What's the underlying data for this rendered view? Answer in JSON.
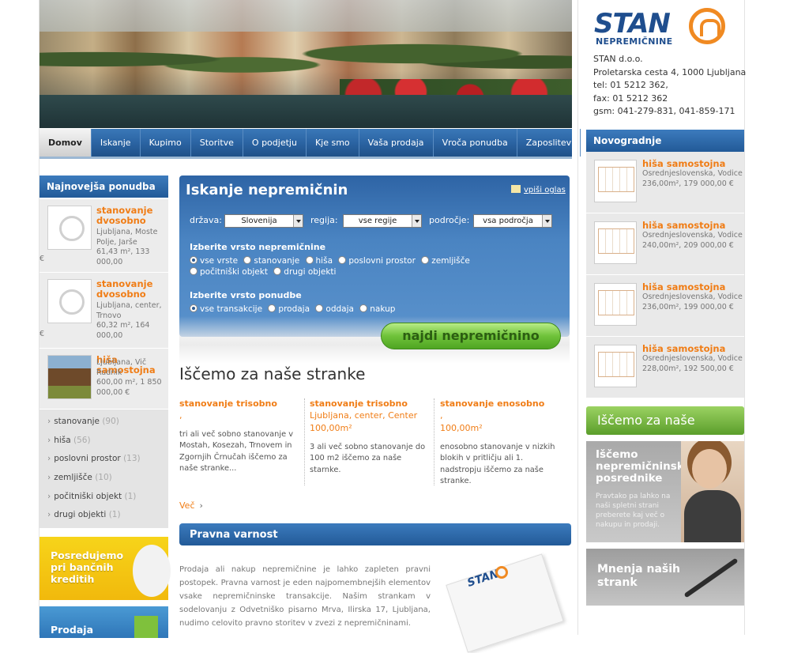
{
  "nav": {
    "items": [
      "Domov",
      "Iskanje",
      "Kupimo",
      "Storitve",
      "O podjetju",
      "Kje smo",
      "Vaša prodaja",
      "Vroča ponudba",
      "Zaposlitev"
    ]
  },
  "logo": {
    "brand": "STAN",
    "sub": "NEPREMIČNINE"
  },
  "company": {
    "name": "STAN d.o.o.",
    "address": "Proletarska cesta 4, 1000 Ljubljana",
    "tel": "tel: 01 5212 362,",
    "fax": "fax: 01 5212 362",
    "gsm": "gsm: 041-279-831, 041-859-171"
  },
  "newest": {
    "heading": "Najnovejša ponudba",
    "items": [
      {
        "title": "stanovanje dvosobno",
        "desc": "Ljubljana, Moste Polje, Jarše",
        "meta": "61,43 m², 133 000,00",
        "cur": "€"
      },
      {
        "title": "stanovanje dvosobno",
        "desc": "Ljubljana, center, Trnovo",
        "meta": "60,32 m², 164 000,00",
        "cur": "€"
      },
      {
        "title": "hiša samostojna",
        "desc": "Ljubljana, Vič Rudnik",
        "meta": "600,00 m², 1 850 000,00 €"
      }
    ]
  },
  "categories": [
    {
      "label": "stanovanje",
      "count": "(90)"
    },
    {
      "label": "hiša",
      "count": "(56)"
    },
    {
      "label": "poslovni prostor",
      "count": "(13)"
    },
    {
      "label": "zemljišče",
      "count": "(10)"
    },
    {
      "label": "počitniški objekt",
      "count": "(1)"
    },
    {
      "label": "drugi objekti",
      "count": "(1)"
    }
  ],
  "banners": {
    "credit": "Posredujemo pri bančnih kreditih",
    "sale": "Prodaja"
  },
  "search": {
    "title": "Iskanje nepremičnin",
    "add_listing": "vpiši oglas",
    "country_label": "država:",
    "country_value": "Slovenija",
    "region_label": "regija:",
    "region_value": "vse regije",
    "area_label": "področje:",
    "area_value": "vsa področja",
    "type_heading": "Izberite vrsto nepremičnine",
    "types": [
      "vse vrste",
      "stanovanje",
      "hiša",
      "poslovni prostor",
      "zemljišče",
      "počitniški objekt",
      "drugi objekti"
    ],
    "offer_heading": "Izberite vrsto ponudbe",
    "offers": [
      "vse transakcije",
      "prodaja",
      "oddaja",
      "nakup"
    ],
    "button": "najdi nepremičnino"
  },
  "wanted": {
    "heading": "Iščemo za naše stranke",
    "items": [
      {
        "title": "stanovanje trisobno",
        "loc": ",",
        "size": "",
        "text": "tri ali več sobno stanovanje v Mostah, Kosezah, Trnovem in Zgornjih Črnučah iščemo za naše stranke..."
      },
      {
        "title": "stanovanje trisobno",
        "loc": "Ljubljana, center, Center",
        "size": "100,00m²",
        "text": "3 ali več sobno stanovanje do 100 m2 iščemo za naše starnke."
      },
      {
        "title": "stanovanje enosobno",
        "loc": ",",
        "size": "100,00m²",
        "text": "enosobno stanovanje v nizkih blokih v pritličju ali 1. nadstropju iščemo za naše stranke."
      }
    ],
    "more": "Več",
    "more_arrow": "›"
  },
  "legal": {
    "heading": "Pravna varnost",
    "text": "Prodaja ali nakup nepremičnine je lahko zapleten pravni postopek. Pravna varnost je eden najpomembnejših elementov vsake nepremičninske transakcije. Našim strankam v sodelovanju z Odvetniško pisarno Mrva, Ilirska 17, Ljubljana, nudimo celovito pravno storitev v zvezi z nepremičninami."
  },
  "hot": {
    "heading": "Novogradnje",
    "items": [
      {
        "title": "hiša samostojna",
        "region": "Osrednjeslovenska, Vodice",
        "meta": "236,00m², 179 000,00 €"
      },
      {
        "title": "hiša samostojna",
        "region": "Osrednjeslovenska, Vodice",
        "meta": "240,00m², 209 000,00 €"
      },
      {
        "title": "hiša samostojna",
        "region": "Osrednjeslovenska, Vodice",
        "meta": "236,00m², 199 000,00 €"
      },
      {
        "title": "hiša samostojna",
        "region": "Osrednjeslovenska, Vodice",
        "meta": "228,00m², 192 500,00 €"
      }
    ]
  },
  "right_banners": {
    "wanted": "Iščemo za naše stranke",
    "agents_title": "Iščemo nepremičninske posrednike",
    "agents_text": "Pravtako pa lahko na naši spletni strani preberete kaj več o nakupu in prodaji.",
    "opinions": "Mnenja naših strank"
  }
}
